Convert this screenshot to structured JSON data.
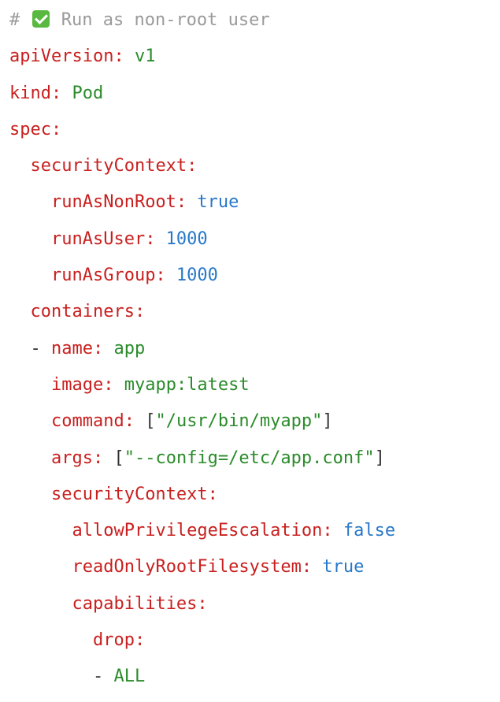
{
  "colors": {
    "comment": "#9a9a9a",
    "key": "#c8201f",
    "string": "#2a8b2a",
    "literal": "#2878c8",
    "punct": "#333333",
    "background": "#ffffff"
  },
  "comment_icon": "check-mark-button-icon",
  "lines": [
    {
      "indent": "",
      "tokens": [
        {
          "t": "comment",
          "v": "# "
        },
        {
          "t": "icon",
          "v": "check-mark-button-icon"
        },
        {
          "t": "comment",
          "v": " Run as non-root user"
        }
      ]
    },
    {
      "indent": "",
      "tokens": [
        {
          "t": "key",
          "v": "apiVersion:"
        },
        {
          "t": "string",
          "v": " v1"
        }
      ]
    },
    {
      "indent": "",
      "tokens": [
        {
          "t": "key",
          "v": "kind:"
        },
        {
          "t": "string",
          "v": " Pod"
        }
      ]
    },
    {
      "indent": "",
      "tokens": [
        {
          "t": "key",
          "v": "spec:"
        }
      ]
    },
    {
      "indent": "  ",
      "tokens": [
        {
          "t": "key",
          "v": "securityContext:"
        }
      ]
    },
    {
      "indent": "    ",
      "tokens": [
        {
          "t": "key",
          "v": "runAsNonRoot:"
        },
        {
          "t": "literal",
          "v": " true"
        }
      ]
    },
    {
      "indent": "    ",
      "tokens": [
        {
          "t": "key",
          "v": "runAsUser:"
        },
        {
          "t": "literal",
          "v": " 1000"
        }
      ]
    },
    {
      "indent": "    ",
      "tokens": [
        {
          "t": "key",
          "v": "runAsGroup:"
        },
        {
          "t": "literal",
          "v": " 1000"
        }
      ]
    },
    {
      "indent": "  ",
      "tokens": [
        {
          "t": "key",
          "v": "containers:"
        }
      ]
    },
    {
      "indent": "  ",
      "tokens": [
        {
          "t": "punct",
          "v": "- "
        },
        {
          "t": "key",
          "v": "name:"
        },
        {
          "t": "string",
          "v": " app"
        }
      ]
    },
    {
      "indent": "    ",
      "tokens": [
        {
          "t": "key",
          "v": "image:"
        },
        {
          "t": "string",
          "v": " myapp:latest"
        }
      ]
    },
    {
      "indent": "    ",
      "tokens": [
        {
          "t": "key",
          "v": "command:"
        },
        {
          "t": "punct",
          "v": " ["
        },
        {
          "t": "string",
          "v": "\"/usr/bin/myapp\""
        },
        {
          "t": "punct",
          "v": "]"
        }
      ]
    },
    {
      "indent": "    ",
      "tokens": [
        {
          "t": "key",
          "v": "args:"
        },
        {
          "t": "punct",
          "v": " ["
        },
        {
          "t": "string",
          "v": "\"--config=/etc/app.conf\""
        },
        {
          "t": "punct",
          "v": "]"
        }
      ]
    },
    {
      "indent": "    ",
      "tokens": [
        {
          "t": "key",
          "v": "securityContext:"
        }
      ]
    },
    {
      "indent": "      ",
      "tokens": [
        {
          "t": "key",
          "v": "allowPrivilegeEscalation:"
        },
        {
          "t": "literal",
          "v": " false"
        }
      ]
    },
    {
      "indent": "      ",
      "tokens": [
        {
          "t": "key",
          "v": "readOnlyRootFilesystem:"
        },
        {
          "t": "literal",
          "v": " true"
        }
      ]
    },
    {
      "indent": "      ",
      "tokens": [
        {
          "t": "key",
          "v": "capabilities:"
        }
      ]
    },
    {
      "indent": "        ",
      "tokens": [
        {
          "t": "key",
          "v": "drop:"
        }
      ]
    },
    {
      "indent": "        ",
      "tokens": [
        {
          "t": "punct",
          "v": "- "
        },
        {
          "t": "string",
          "v": "ALL"
        }
      ]
    }
  ]
}
